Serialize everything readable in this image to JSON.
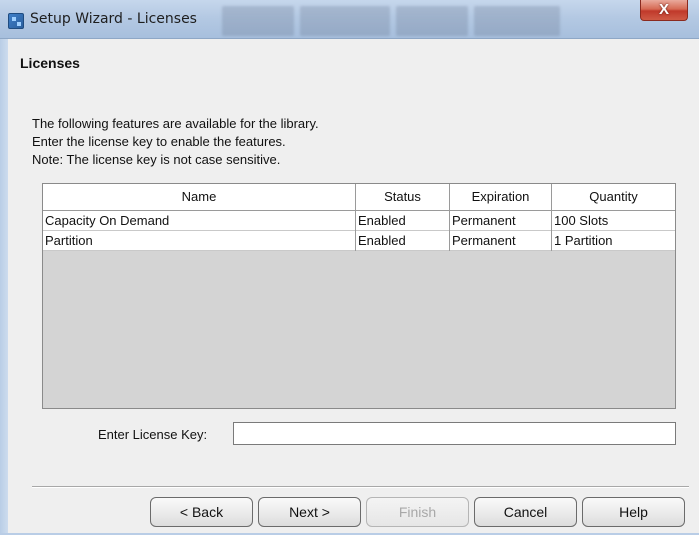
{
  "window": {
    "title": "Setup Wizard - Licenses",
    "close_glyph": "X"
  },
  "section_title": "Licenses",
  "description": [
    "The following features are available for the library.",
    "Enter the license key to enable the features.",
    "Note: The license key is not case sensitive."
  ],
  "table": {
    "columns": [
      "Name",
      "Status",
      "Expiration",
      "Quantity"
    ],
    "rows": [
      [
        "Capacity On Demand",
        "Enabled",
        "Permanent",
        "100 Slots"
      ],
      [
        "Partition",
        "Enabled",
        "Permanent",
        "1 Partition"
      ]
    ]
  },
  "license_key": {
    "label": "Enter License Key:",
    "value": "",
    "placeholder": ""
  },
  "buttons": {
    "back": "< Back",
    "next": "Next >",
    "finish": "Finish",
    "cancel": "Cancel",
    "help": "Help"
  },
  "icons": {
    "app": "setup-wizard-app-icon",
    "close": "close-icon"
  },
  "colors": {
    "close_button": "#c0392b",
    "titlebar": "#b4c9e3",
    "dialog_background": "#efefef",
    "table_empty_area": "#d4d4d4"
  }
}
